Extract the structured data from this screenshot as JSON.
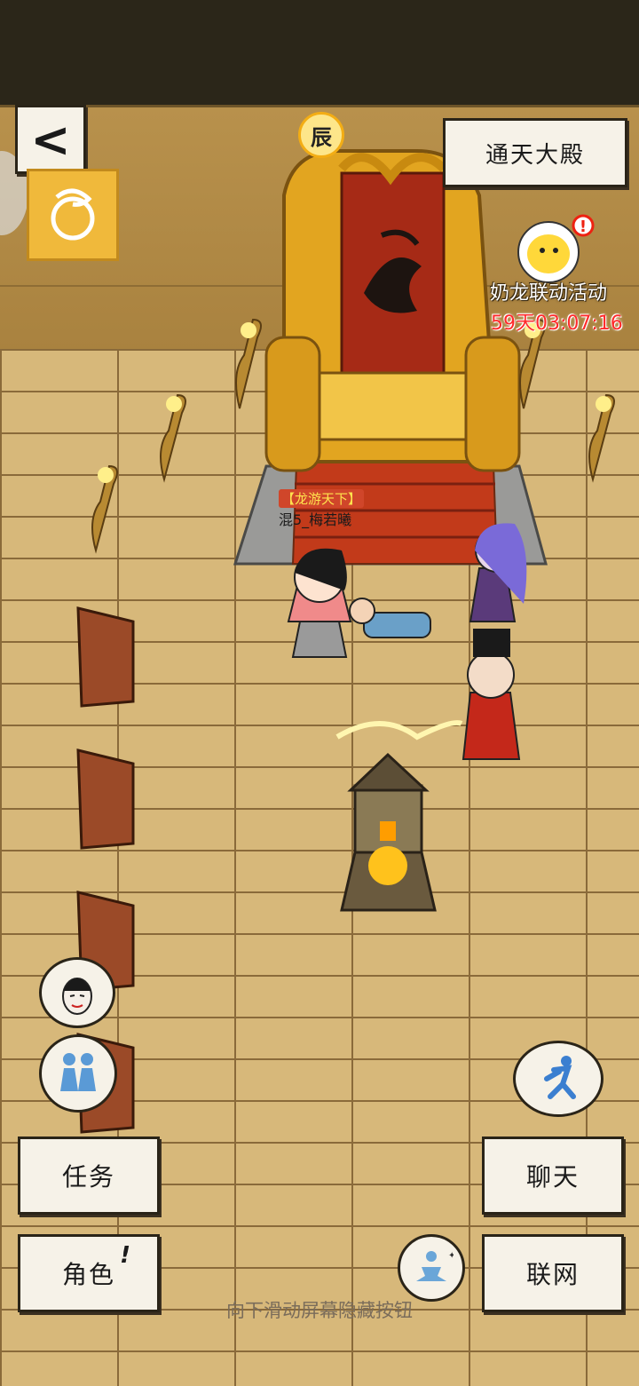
{
  "location": {
    "name": "通天大殿"
  },
  "time_of_day": {
    "symbol": "辰"
  },
  "event": {
    "title": "奶龙联动活动",
    "timer": "59天03:07:16"
  },
  "player": {
    "guild_tag": "【龙游天下】",
    "name": "混5_梅若曦"
  },
  "buttons": {
    "task": "任务",
    "role": "角色",
    "role_alert": "!",
    "chat": "聊天",
    "network": "联网",
    "back": "<"
  },
  "hint": "向下滑动屏幕隐藏按钮",
  "colors": {
    "gold": "#e2a520",
    "carpet_red": "#b03018",
    "paper": "#f6f2e8",
    "timer_red": "#ff2a2a"
  }
}
